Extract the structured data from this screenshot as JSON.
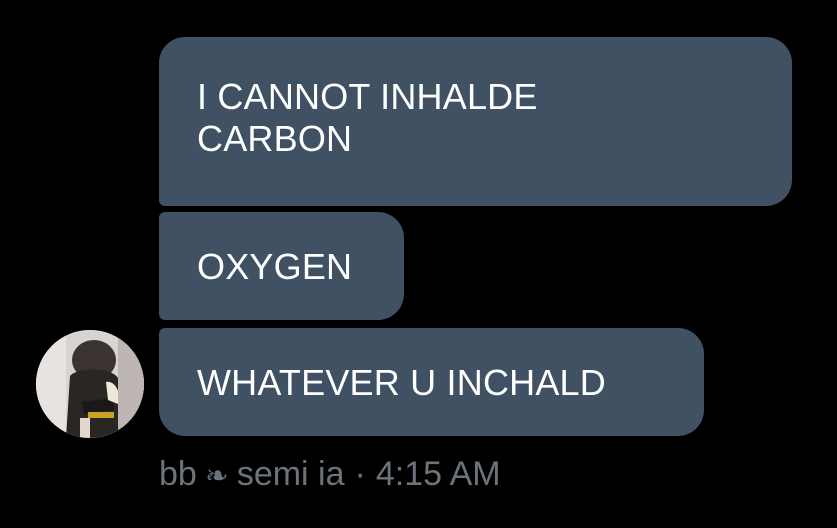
{
  "messages": [
    {
      "lines": [
        "I CANNOT INHALDE",
        "CARBON"
      ]
    },
    {
      "text": "OXYGEN"
    },
    {
      "text": "WHATEVER U INCHALD"
    }
  ],
  "meta": {
    "name_a": "bb",
    "icon": "rotated-floral-heart-icon",
    "name_b": "semi ia",
    "separator": "·",
    "time": "4:15 AM"
  },
  "colors": {
    "background": "#000000",
    "bubble": "#3f5163",
    "text": "#ffffff",
    "meta": "#6c737b"
  }
}
